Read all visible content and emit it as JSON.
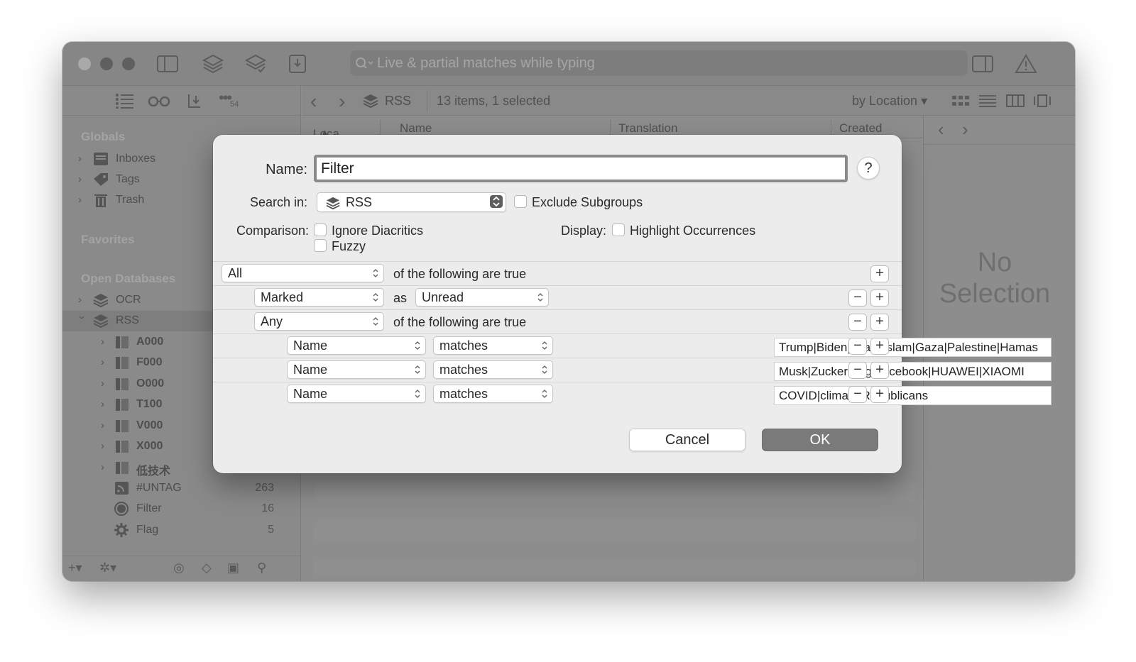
{
  "toolbar": {
    "search_placeholder": "Live & partial matches while typing"
  },
  "sidebar": {
    "sections": {
      "globals": "Globals",
      "favorites": "Favorites",
      "open_databases": "Open Databases"
    },
    "globals": [
      {
        "label": "Inboxes",
        "icon": "inbox-icon"
      },
      {
        "label": "Tags",
        "icon": "tag-icon"
      },
      {
        "label": "Trash",
        "icon": "trash-icon"
      }
    ],
    "databases": [
      {
        "label": "OCR",
        "icon": "database-icon",
        "expanded": false
      },
      {
        "label": "RSS",
        "icon": "database-icon",
        "expanded": true,
        "selected": true
      }
    ],
    "groups": [
      {
        "label": "A000"
      },
      {
        "label": "F000"
      },
      {
        "label": "O000"
      },
      {
        "label": "T100"
      },
      {
        "label": "V000"
      },
      {
        "label": "X000"
      },
      {
        "label": "低技术"
      }
    ],
    "items": [
      {
        "label": "#UNTAG",
        "count": "263",
        "icon": "rss-feed-icon"
      },
      {
        "label": "Filter",
        "count": "16",
        "icon": "smart-group-icon"
      },
      {
        "label": "Flag",
        "count": "5",
        "icon": "gear-icon"
      }
    ],
    "tools_badge": "54"
  },
  "main": {
    "location": "RSS",
    "item_count": "13 items, 1 selected",
    "sort_by": "by Location",
    "columns": [
      "Loca...",
      "Name",
      "Translation",
      "Created"
    ],
    "no_selection": "No Selection"
  },
  "dialog": {
    "name_label": "Name:",
    "name_value": "Filter",
    "help": "?",
    "search_in_label": "Search in:",
    "search_in_value": "RSS",
    "exclude_subgroups": "Exclude Subgroups",
    "comparison_label": "Comparison:",
    "ignore_diacritics": "Ignore Diacritics",
    "fuzzy": "Fuzzy",
    "display_label": "Display:",
    "highlight_occurrences": "Highlight Occurrences",
    "rules": {
      "top_quantifier": "All",
      "top_text": "of the following are true",
      "marked_field": "Marked",
      "as_text": "as",
      "marked_value": "Unread",
      "nested_quantifier": "Any",
      "nested_text": "of the following are true",
      "conditions": [
        {
          "field": "Name",
          "operator": "matches",
          "value": "Trump|Biden|Israel|Islam|Gaza|Palestine|Hamas"
        },
        {
          "field": "Name",
          "operator": "matches",
          "value": "Musk|Zuckerberg|Facebook|HUAWEI|XIAOMI"
        },
        {
          "field": "Name",
          "operator": "matches",
          "value": "COVID|climate|Republicans"
        }
      ]
    },
    "cancel": "Cancel",
    "ok": "OK"
  }
}
